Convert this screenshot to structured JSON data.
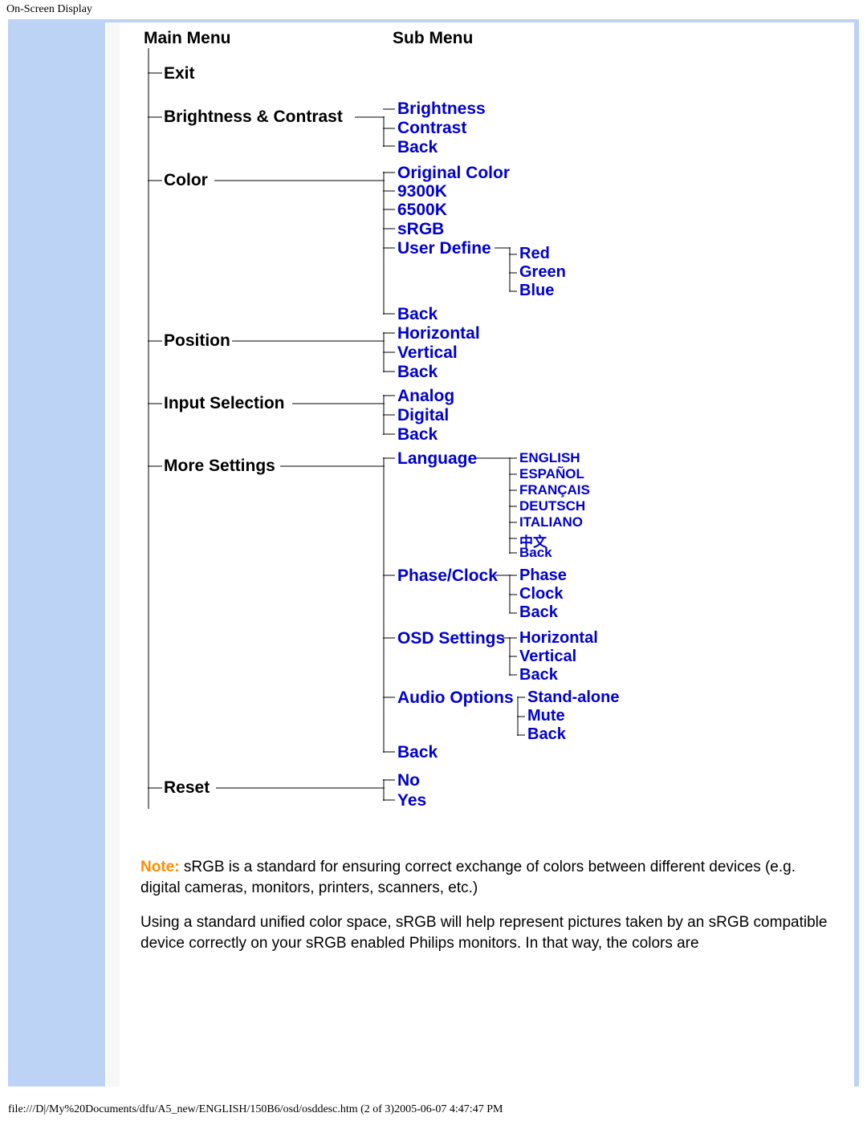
{
  "page_title": "On-Screen Display",
  "headers": {
    "main": "Main Menu",
    "sub": "Sub Menu"
  },
  "main_items": {
    "exit": "Exit",
    "brightness_contrast": "Brightness & Contrast",
    "color": "Color",
    "position": "Position",
    "input_selection": "Input Selection",
    "more_settings": "More Settings",
    "reset": "Reset"
  },
  "sub": {
    "bc": [
      "Brightness",
      "Contrast",
      "Back"
    ],
    "color": [
      "Original Color",
      "9300K",
      "6500K",
      "sRGB",
      "User Define",
      "Back"
    ],
    "user_define": [
      "Red",
      "Green",
      "Blue"
    ],
    "position": [
      "Horizontal",
      "Vertical",
      "Back"
    ],
    "input": [
      "Analog",
      "Digital",
      "Back"
    ],
    "more": [
      "Language",
      "Phase/Clock",
      "OSD Settings",
      "Audio Options",
      "Back"
    ],
    "language": [
      "ENGLISH",
      "ESPAÑOL",
      "FRANÇAIS",
      "DEUTSCH",
      "ITALIANO",
      "中文",
      "Back"
    ],
    "phase_clock": [
      "Phase",
      "Clock",
      "Back"
    ],
    "osd_settings": [
      "Horizontal",
      "Vertical",
      "Back"
    ],
    "audio": [
      "Stand-alone",
      "Mute",
      "Back"
    ],
    "reset": [
      "No",
      "Yes"
    ]
  },
  "note": {
    "label": "Note:",
    "p1_rest": " sRGB is a standard for ensuring correct exchange of colors between different devices (e.g. digital cameras, monitors, printers, scanners, etc.)",
    "p2": "Using a standard unified color space, sRGB will help represent pictures taken by an sRGB compatible device correctly on your sRGB enabled Philips monitors. In that way, the colors are"
  },
  "footer": "file:///D|/My%20Documents/dfu/A5_new/ENGLISH/150B6/osd/osddesc.htm (2 of 3)2005-06-07 4:47:47 PM"
}
